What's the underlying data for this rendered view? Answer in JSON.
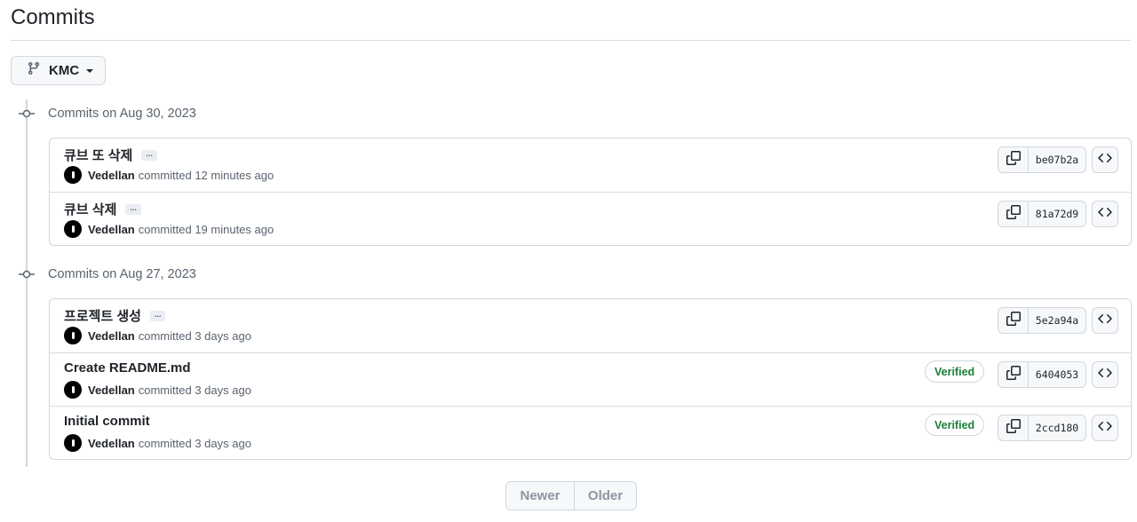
{
  "page": {
    "title": "Commits"
  },
  "branch": {
    "label": "KMC",
    "icon": "git-branch-icon"
  },
  "groups": [
    {
      "label": "Commits on Aug 30, 2023",
      "commits": [
        {
          "message": "큐브 또 삭제",
          "author": "Vedellan",
          "time": "committed 12 minutes ago",
          "sha": "be07b2a",
          "verified": "",
          "ellipsis": "..."
        },
        {
          "message": "큐브 삭제",
          "author": "Vedellan",
          "time": "committed 19 minutes ago",
          "sha": "81a72d9",
          "verified": "",
          "ellipsis": "..."
        }
      ]
    },
    {
      "label": "Commits on Aug 27, 2023",
      "commits": [
        {
          "message": "프로젝트 생성",
          "author": "Vedellan",
          "time": "committed 3 days ago",
          "sha": "5e2a94a",
          "verified": "",
          "ellipsis": "..."
        },
        {
          "message": "Create README.md",
          "author": "Vedellan",
          "time": "committed 3 days ago",
          "sha": "6404053",
          "verified": "Verified",
          "ellipsis": ""
        },
        {
          "message": "Initial commit",
          "author": "Vedellan",
          "time": "committed 3 days ago",
          "sha": "2ccd180",
          "verified": "Verified",
          "ellipsis": ""
        }
      ]
    }
  ],
  "pagination": {
    "newer": "Newer",
    "older": "Older"
  },
  "colors": {
    "verified": "#1a7f37",
    "border": "#d0d7de",
    "muted": "#59636e"
  }
}
